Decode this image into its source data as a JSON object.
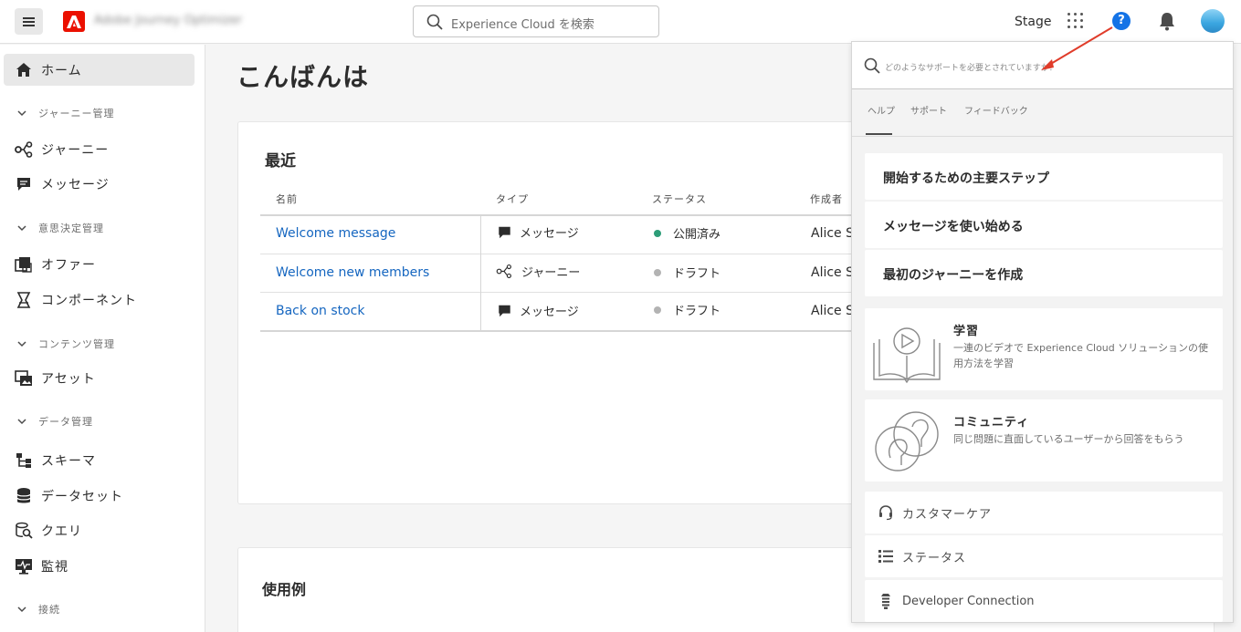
{
  "header": {
    "product_name": "Adobe Journey Optimizer",
    "search_placeholder": "Experience Cloud を検索",
    "sandbox": "Stage",
    "help_glyph": "?",
    "icons": [
      "menu-icon",
      "adobe-logo",
      "search-icon",
      "apps-grid-icon",
      "help-icon",
      "bell-icon",
      "avatar"
    ]
  },
  "sidebar": {
    "home": "ホーム",
    "sections": {
      "journey_mgmt": "ジャーニー管理",
      "decision_mgmt": "意思決定管理",
      "content_mgmt": "コンテンツ管理",
      "data_mgmt": "データ管理",
      "connections": "接続"
    },
    "items": {
      "journeys": "ジャーニー",
      "messages": "メッセージ",
      "offers": "オファー",
      "components": "コンポーネント",
      "assets": "アセット",
      "schemas": "スキーマ",
      "datasets": "データセット",
      "queries": "クエリ",
      "monitoring": "監視"
    }
  },
  "main": {
    "greeting": "こんばんは",
    "recent": {
      "title": "最近",
      "columns": {
        "name": "名前",
        "type": "タイプ",
        "status": "ステータス",
        "author": "作成者"
      },
      "rows": [
        {
          "name": "Welcome message",
          "type": "メッセージ",
          "status": "公開済み",
          "status_color": "#2d9d78",
          "author": "Alice S"
        },
        {
          "name": "Welcome new members",
          "type": "ジャーニー",
          "status": "ドラフト",
          "status_color": "#b3b3b3",
          "author": "Alice S"
        },
        {
          "name": "Back on stock",
          "type": "メッセージ",
          "status": "ドラフト",
          "status_color": "#b3b3b3",
          "author": "Alice S"
        }
      ]
    },
    "use_cases": {
      "title": "使用例"
    }
  },
  "help_panel": {
    "search_placeholder": "どのようなサポートを必要とされていますか？",
    "tabs": [
      "ヘルプ",
      "サポート",
      "フィードバック"
    ],
    "active_tab": "ヘルプ",
    "links": [
      "開始するための主要ステップ",
      "メッセージを使い始める",
      "最初のジャーニーを作成"
    ],
    "learn": {
      "title": "学習",
      "description": "一連のビデオで Experience Cloud ソリューションの使用方法を学習"
    },
    "community": {
      "title": "コミュニティ",
      "description": "同じ問題に直面しているユーザーから回答をもらう"
    },
    "rows": [
      {
        "label": "カスタマーケア",
        "icon": "headset-icon"
      },
      {
        "label": "ステータス",
        "icon": "status-list-icon"
      },
      {
        "label": "Developer Connection",
        "icon": "developer-icon"
      }
    ]
  },
  "colors": {
    "accent": "#1473e6",
    "link": "#1566c0",
    "adobe_red": "#eb1000",
    "annotation": "#e03c2a"
  }
}
